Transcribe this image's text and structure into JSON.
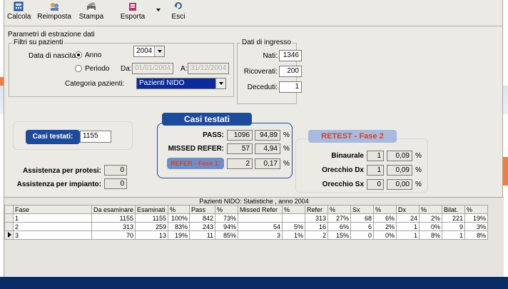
{
  "toolbar": {
    "items": [
      {
        "label": "Calcola",
        "icon": "calculator-icon"
      },
      {
        "label": "Reimposta",
        "icon": "reset-icon"
      },
      {
        "label": "Stampa",
        "icon": "printer-icon"
      },
      {
        "label": "Esporta",
        "icon": "export-icon"
      },
      {
        "label": "Esci",
        "icon": "exit-icon"
      }
    ]
  },
  "params": {
    "title": "Parametri di estrazione dati",
    "filters_title": "Filtri su pazienti",
    "birth_label": "Data di nascita:",
    "radio_year": "Anno",
    "radio_period": "Periodo",
    "year_value": "2004",
    "from_label": "Da:",
    "from_value": "01/01/2004",
    "to_label": "A:",
    "to_value": "31/12/2004",
    "category_label": "Categoria pazienti:",
    "category_value": "Pazienti NIDO"
  },
  "input_data": {
    "title": "Dati di ingresso",
    "nati_label": "Nati:",
    "nati_value": "1346",
    "ricoverati_label": "Ricoverati:",
    "ricoverati_value": "200",
    "deceduti_label": "Deceduti:",
    "deceduti_value": "1"
  },
  "summary": {
    "tested_label": "Casi testati:",
    "tested_value": "1155",
    "tested_header": "Casi testati",
    "pass_label": "PASS:",
    "pass_value": "1096",
    "pass_pct": "94,89",
    "missed_label": "MISSED REFER:",
    "missed_value": "57",
    "missed_pct": "4,94",
    "refer1_label": "REFER - Fase 1:",
    "refer1_value": "2",
    "refer1_pct": "0,17",
    "refer2_header": "RETEST - Fase 2",
    "bin_label": "Binaurale",
    "bin_value": "1",
    "bin_pct": "0,09",
    "dx_label": "Orecchio Dx",
    "dx_value": "1",
    "dx_pct": "0,09",
    "sx_label": "Orecchio Sx",
    "sx_value": "0",
    "sx_pct": "0,00",
    "pct_sign": "%",
    "protesi_label": "Assistenza per protesi:",
    "protesi_value": "0",
    "impianto_label": "Assistenza per impianto:",
    "impianto_value": "0"
  },
  "grid": {
    "title": "Pazienti NIDO: Statistiche , anno 2004",
    "columns": [
      "Fase",
      "Da esaminare",
      "Esaminati",
      "%",
      "Pass",
      "%",
      "Missed Refer",
      "%",
      "Refer",
      "%",
      "Sx",
      "%",
      "Dx",
      "%",
      "Bilat.",
      "%"
    ],
    "rows": [
      [
        "1",
        "1155",
        "1155",
        "100%",
        "842",
        "73%",
        "",
        "",
        "313",
        "27%",
        "68",
        "6%",
        "24",
        "2%",
        "221",
        "19%"
      ],
      [
        "2",
        "313",
        "259",
        "83%",
        "243",
        "94%",
        "54",
        "5%",
        "16",
        "6%",
        "6",
        "2%",
        "1",
        "0%",
        "9",
        "3%"
      ],
      [
        "3",
        "70",
        "13",
        "19%",
        "11",
        "85%",
        "3",
        "1%",
        "2",
        "15%",
        "0",
        "0%",
        "1",
        "8%",
        "1",
        "8%"
      ]
    ]
  },
  "colors": {
    "accent_blue": "#1d4b9c",
    "refer_red": "#e04020",
    "selection_blue": "#0a2a9e"
  }
}
